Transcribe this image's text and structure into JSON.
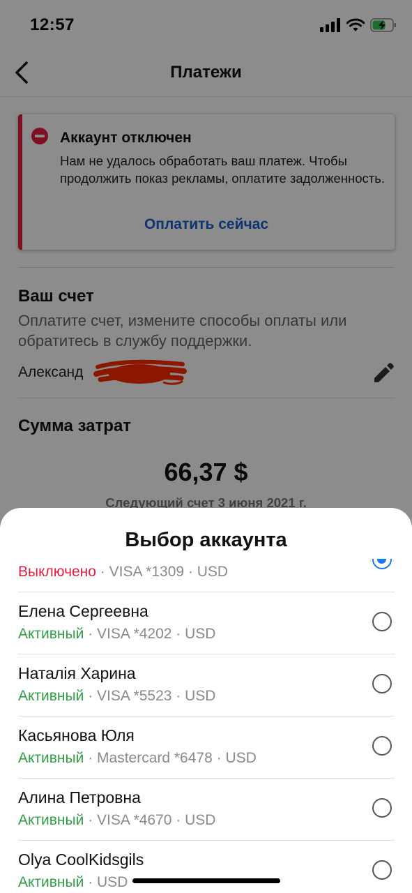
{
  "status_bar": {
    "time": "12:57"
  },
  "nav": {
    "title": "Платежи"
  },
  "alert": {
    "title": "Аккаунт отключен",
    "text": "Нам не удалось обработать ваш платеж. Чтобы продолжить показ рекламы, оплатите задолженность.",
    "action": "Оплатить сейчас",
    "accent_color": "#e41e3f",
    "link_color": "#1b5fd1"
  },
  "billing": {
    "title": "Ваш счет",
    "subtitle": "Оплатите счет, измените способы оплаты или обратитесь в службу поддержки.",
    "owner_visible": "Александ"
  },
  "spend": {
    "title": "Сумма затрат",
    "amount": "66,37 $",
    "next_bill": "Следующий счет 3 июня 2021 г."
  },
  "sheet": {
    "title": "Выбор аккаунта",
    "accounts": [
      {
        "name": "",
        "status": "Выключено",
        "details": " · VISA *1309 · USD",
        "selected": true
      },
      {
        "name": "Елена Сергеевна",
        "status": "Активный",
        "details": " · VISA *4202 · USD",
        "selected": false
      },
      {
        "name": "Наталія Харина",
        "status": "Активный",
        "details": " · VISA *5523 · USD",
        "selected": false
      },
      {
        "name": "Касьянова Юля",
        "status": "Активный",
        "details": " · Mastercard *6478 · USD",
        "selected": false
      },
      {
        "name": "Алина Петровна",
        "status": "Активный",
        "details": " · VISA *4670 · USD",
        "selected": false
      },
      {
        "name": "Olya CoolKidsgils",
        "status": "Активный",
        "details": " · USD",
        "selected": false
      }
    ]
  },
  "colors": {
    "active": "#2f9e44",
    "disabled": "#e41e3f",
    "radio_selected": "#1877f2"
  },
  "icons": [
    "back-chevron-icon",
    "signal-icon",
    "wifi-icon",
    "battery-charging-icon",
    "error-stop-icon",
    "pencil-edit-icon",
    "radio-button-icon"
  ]
}
